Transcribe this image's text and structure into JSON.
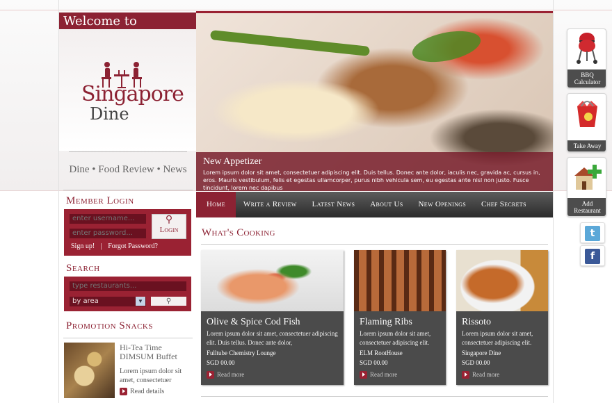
{
  "brand": {
    "welcome": "Welcome to",
    "name_line1": "Singapore",
    "name_line2": "Dine",
    "tagline": "Dine • Food Review • News"
  },
  "login": {
    "title": "Member Login",
    "username_placeholder": "enter username...",
    "password_placeholder": "enter password...",
    "button": "Login",
    "signup": "Sign up!",
    "separator": "|",
    "forgot": "Forgot Password?"
  },
  "search": {
    "title": "Search",
    "placeholder": "type restaurants...",
    "filter": "by area"
  },
  "promo": {
    "title": "Promotion Snacks",
    "item_title": "Hi-Tea Time DIMSUM Buffet",
    "item_text": "Lorem ipsum dolor sit amet, consectetuer",
    "item_link": "Read details"
  },
  "hero": {
    "title": "New Appetizer",
    "text": "Lorem ipsum dolor sit amet, consectetuer adipiscing elit. Duis tellus. Donec ante dolor, iaculis nec, gravida ac, cursus in, eros. Mauris vestibulum, felis et egestas ullamcorper, purus nibh vehicula sem, eu egestas ante nisl non justo. Fusce tincidunt, lorem nec dapibus"
  },
  "nav": [
    "Home",
    "Write a Review",
    "Latest News",
    "About Us",
    "New Openings",
    "Chef Secrets"
  ],
  "section_title": "What's Cooking",
  "cards": [
    {
      "title": "Olive & Spice Cod Fish",
      "desc": "Lorem ipsum dolor sit amet, consectetuer adipiscing elit. Duis tellus. Donec ante dolor,",
      "place": "Fulltube Chemistry Lounge",
      "price": "SGD 00.00",
      "more": "Read more"
    },
    {
      "title": "Flaming Ribs",
      "desc": "Lorem ipsum dolor sit amet, consectetuer adipiscing elit.",
      "place": "ELM RootHouse",
      "price": "SGD 00.00",
      "more": "Read more"
    },
    {
      "title": "Rissoto",
      "desc": "Lorem ipsum dolor sit amet, consectetuer adipiscing elit.",
      "place": "Singapore Dine",
      "price": "SGD 00.00",
      "more": "Read more"
    }
  ],
  "widgets": [
    {
      "label": "BBQ Calculator",
      "icon": "bbq-grill-icon"
    },
    {
      "label": "Take Away",
      "icon": "takeaway-box-icon"
    },
    {
      "label": "Add Restaurant",
      "icon": "add-restaurant-icon"
    }
  ],
  "social": [
    {
      "icon": "twitter-icon",
      "glyph": "t",
      "color": "#5ba8d8"
    },
    {
      "icon": "facebook-icon",
      "glyph": "f",
      "color": "#3b5998"
    }
  ],
  "colors": {
    "accent": "#8c2233",
    "nav": "#3a3a3a",
    "card": "#4b4b4b"
  }
}
